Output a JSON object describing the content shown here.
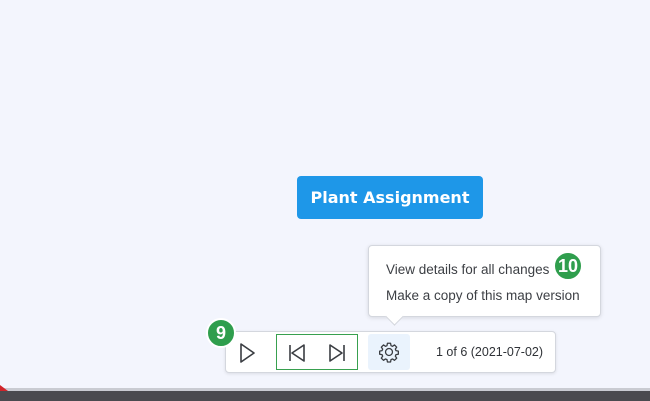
{
  "map": {
    "topic_label": "Plant Assignment"
  },
  "menu": {
    "items": [
      {
        "label": "View details for all changes"
      },
      {
        "label": "Make a copy of this map version"
      }
    ]
  },
  "badges": {
    "menu_badge": "10",
    "toolbar_badge": "9"
  },
  "toolbar": {
    "play_icon": "play-icon",
    "prev_icon": "skip-back-icon",
    "next_icon": "skip-forward-icon",
    "settings_icon": "gear-icon",
    "version_label": "1 of 6 (2021-07-02)"
  },
  "colors": {
    "topic_fill": "#1e97e8",
    "badge_green": "#2f9e4d",
    "step_group_border": "#38a04f",
    "canvas_bg": "#f3f5fd"
  }
}
